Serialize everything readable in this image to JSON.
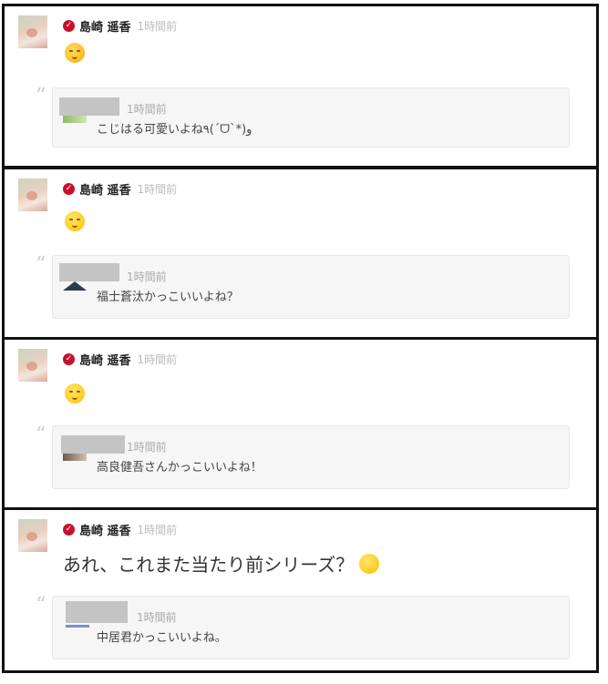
{
  "posts": [
    {
      "author": "島崎 遥香",
      "time": "1時間前",
      "quote": {
        "time": "1時間前",
        "text": "こじはる可愛いよね٩(ˊᗜˋ*)و"
      }
    },
    {
      "author": "島崎 遥香",
      "time": "1時間前",
      "quote": {
        "time": "1時間前",
        "text": "福士蒼汰かっこいいよね？"
      }
    },
    {
      "author": "島崎 遥香",
      "time": "1時間前",
      "quote": {
        "time": "1時間前",
        "text": "高良健吾さんかっこいいよね！"
      }
    },
    {
      "author": "島崎 遥香",
      "time": "1時間前",
      "body": "あれ、これまた当たり前シリーズ？",
      "quote": {
        "time": "1時間前",
        "text": "中居君かっこいいよね。"
      }
    }
  ],
  "quote_mark": "“",
  "verified_check": "✓"
}
